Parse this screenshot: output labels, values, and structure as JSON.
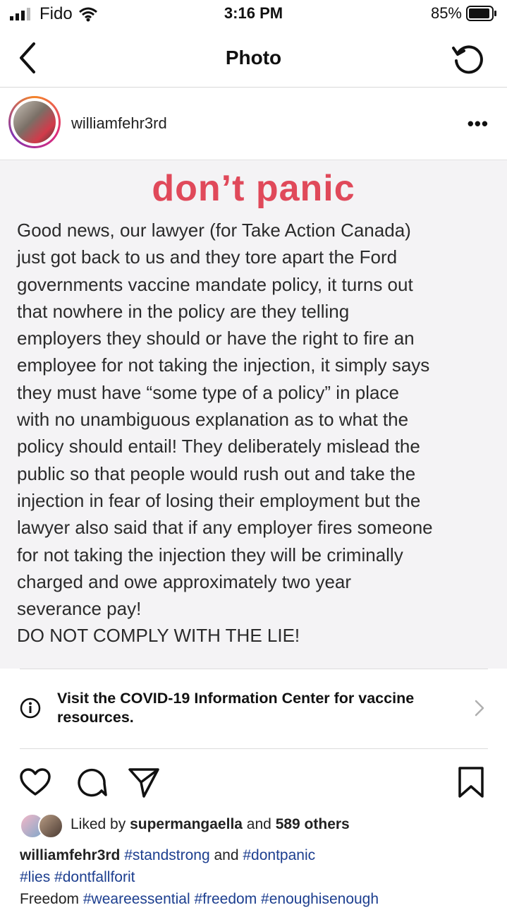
{
  "status_bar": {
    "carrier": "Fido",
    "time": "3:16 PM",
    "battery": "85%"
  },
  "nav": {
    "title": "Photo"
  },
  "post": {
    "username": "williamfehr3rd",
    "more_label": "•••"
  },
  "photo": {
    "title": "don’t panic",
    "body": "Good news, our lawyer (for Take Action Canada)\njust got back to us and they tore apart the Ford\ngovernments vaccine mandate policy, it turns out\nthat nowhere in the policy are they telling\nemployers they should or have the right to fire an\nemployee for not taking the injection, it simply says\nthey must have “some type of a policy” in place\nwith no unambiguous explanation as to what the\npolicy should entail! They deliberately mislead the\npublic so that people would rush out and take the\ninjection in fear of losing their employment but the\nlawyer also said that if any employer fires someone\nfor not taking the injection they will be criminally\ncharged and owe approximately two year\nseverance pay!\nDO NOT COMPLY WITH THE LIE!"
  },
  "covid_banner": {
    "text": "Visit the COVID-19 Information Center for vaccine resources."
  },
  "likes": {
    "prefix": "Liked by ",
    "user": "supermangaella",
    "middle": " and ",
    "others": "589 others"
  },
  "caption": {
    "username": "williamfehr3rd",
    "tag1": "#standstrong",
    "and": " and ",
    "tag2": "#dontpanic",
    "tag3": "#lies",
    "tag4": "#dontfallforit",
    "word": "Freedom",
    "tag5": "#weareessential",
    "tag6": "#freedom",
    "tag7": "#enoughisenough"
  },
  "colors": {
    "photo_title": "#e0495a",
    "hashtag": "#1c3e8f"
  }
}
